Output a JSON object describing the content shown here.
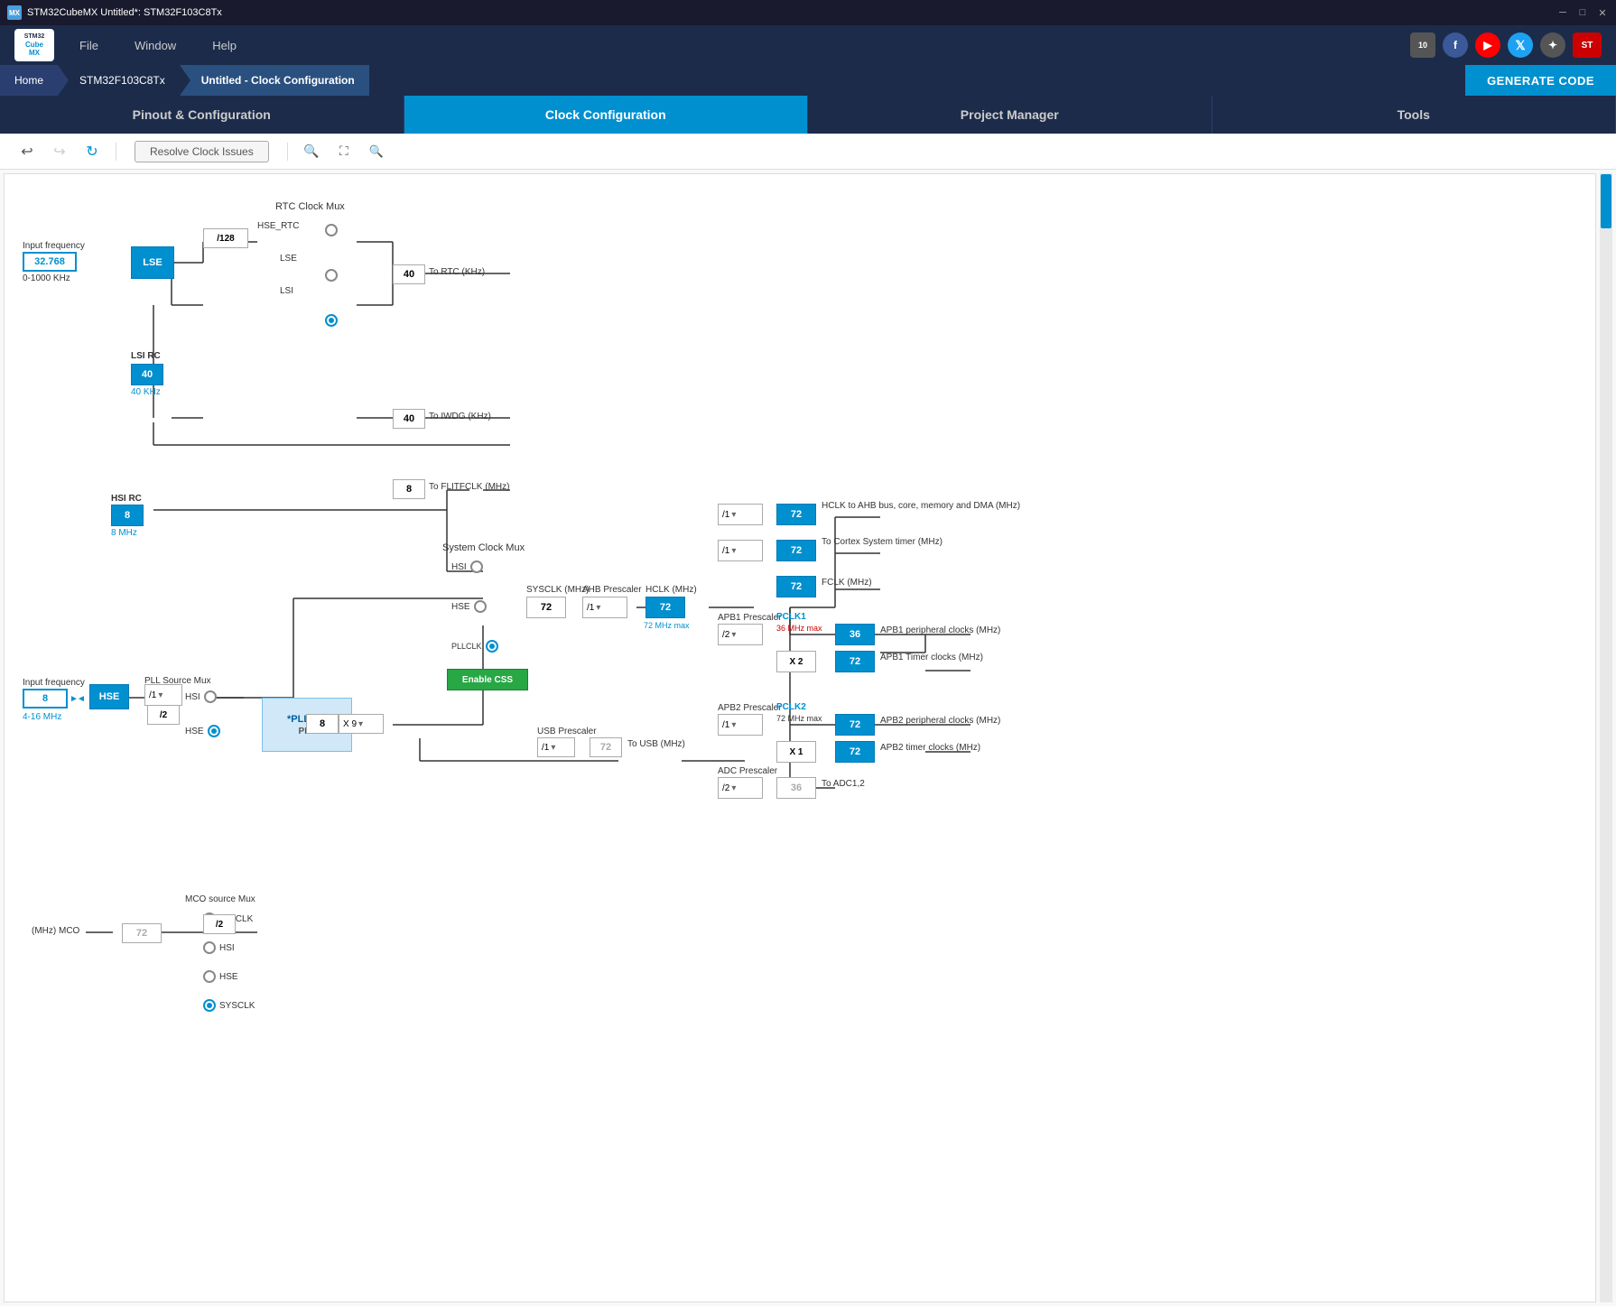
{
  "titleBar": {
    "icon": "MX",
    "title": "STM32CubeMX Untitled*: STM32F103C8Tx",
    "minimize": "─",
    "maximize": "□",
    "close": "✕"
  },
  "menuBar": {
    "items": [
      "File",
      "Window",
      "Help"
    ],
    "socialIcons": [
      {
        "id": "badge",
        "label": "10",
        "type": "badge"
      },
      {
        "id": "facebook",
        "label": "f",
        "type": "fb"
      },
      {
        "id": "youtube",
        "label": "▶",
        "type": "yt"
      },
      {
        "id": "twitter",
        "label": "🐦",
        "type": "tw"
      },
      {
        "id": "network",
        "label": "✦",
        "type": "net"
      },
      {
        "id": "st",
        "label": "ST",
        "type": "st"
      }
    ]
  },
  "breadcrumb": {
    "items": [
      {
        "label": "Home",
        "type": "home"
      },
      {
        "label": "STM32F103C8Tx",
        "type": "normal"
      },
      {
        "label": "Untitled - Clock Configuration",
        "type": "active"
      }
    ],
    "generateCode": "GENERATE CODE"
  },
  "tabs": [
    {
      "label": "Pinout & Configuration",
      "active": false
    },
    {
      "label": "Clock Configuration",
      "active": true
    },
    {
      "label": "Project Manager",
      "active": false
    },
    {
      "label": "Tools",
      "active": false
    }
  ],
  "toolbar": {
    "undo": "↩",
    "redo": "↪",
    "refresh": "↻",
    "resolveClockIssues": "Resolve Clock Issues",
    "zoomIn": "🔍",
    "fitScreen": "⛶",
    "zoomOut": "🔍"
  },
  "diagram": {
    "nodes": {
      "lse_input_freq": "32.768",
      "lse_input_range": "0-1000 KHz",
      "lse": "LSE",
      "lsi_rc": "LSI RC",
      "lsi_value": "40",
      "lsi_label": "40 KHz",
      "rtc_clock_mux": "RTC Clock Mux",
      "hse_rtc": "HSE_RTC",
      "div128": "/128",
      "to_rtc": "To RTC (KHz)",
      "to_rtc_val": "40",
      "to_iwdg": "To IWDG (KHz)",
      "to_iwdg_val": "40",
      "to_flitfclk": "To FLITFCLK (MHz)",
      "to_flitfclk_val": "8",
      "hsi_rc": "HSI RC",
      "hsi_value": "8",
      "hsi_label": "8 MHz",
      "system_clock_mux": "System Clock Mux",
      "hsi_label_mux": "HSI",
      "hse_label_mux": "HSE",
      "pllclk_label": "PLLCLK",
      "enable_css": "Enable CSS",
      "sysclk_mhz": "SYSCLK (MHz)",
      "sysclk_val": "72",
      "ahb_prescaler": "AHB Prescaler",
      "ahb_div": "/1",
      "hclk_mhz": "HCLK (MHz)",
      "hclk_val": "72",
      "hclk_max": "72 MHz max",
      "hclk_to_ahb": "HCLK to AHB bus, core, memory and DMA (MHz)",
      "hclk_to_ahb_val": "72",
      "cortex_timer": "To Cortex System timer (MHz)",
      "cortex_timer_val": "72",
      "div1_cortex": "/1",
      "fclk": "FCLK (MHz)",
      "fclk_val": "72",
      "apb1_prescaler": "APB1 Prescaler",
      "apb1_div": "/2",
      "pclk1": "PCLK1",
      "pclk1_max": "36 MHz max",
      "apb1_periph": "APB1 peripheral clocks (MHz)",
      "apb1_periph_val": "36",
      "apb1_timer": "APB1 Timer clocks (MHz)",
      "apb1_timer_val": "72",
      "x2_apb1": "X 2",
      "apb2_prescaler": "APB2 Prescaler",
      "apb2_div": "/1",
      "pclk2": "PCLK2",
      "pclk2_max": "72 MHz max",
      "apb2_periph": "APB2 peripheral clocks (MHz)",
      "apb2_periph_val": "72",
      "apb2_timer": "APB2 timer clocks (MHz)",
      "apb2_timer_val": "72",
      "x1_apb2": "X 1",
      "adc_prescaler": "ADC Prescaler",
      "adc_div": "/2",
      "to_adc": "To ADC1,2",
      "to_adc_val": "36",
      "pll_source_mux": "PLL Source Mux",
      "hsi_pll": "HSI",
      "hse_pll": "HSE",
      "hse_input_freq": "8",
      "hse_label": "HSE",
      "hse_range": "4-16 MHz",
      "hse_div1": "/1",
      "pll_div2": "/2",
      "pll_box": "*PLLMul",
      "pll_label": "PLL",
      "pll_mul_val": "8",
      "pll_mul_select": "X 9",
      "usb_prescaler": "USB Prescaler",
      "usb_div": "/1",
      "to_usb": "To USB (MHz)",
      "to_usb_val": "72",
      "mco_source_mux": "MCO source Mux",
      "mco_pllclk": "PLLCLK",
      "mco_hsi": "HSI",
      "mco_hse": "HSE",
      "mco_sysclk": "SYSCLK",
      "mco_div2": "/2",
      "mhz_mco": "(MHz) MCO",
      "mco_val": "72"
    }
  }
}
